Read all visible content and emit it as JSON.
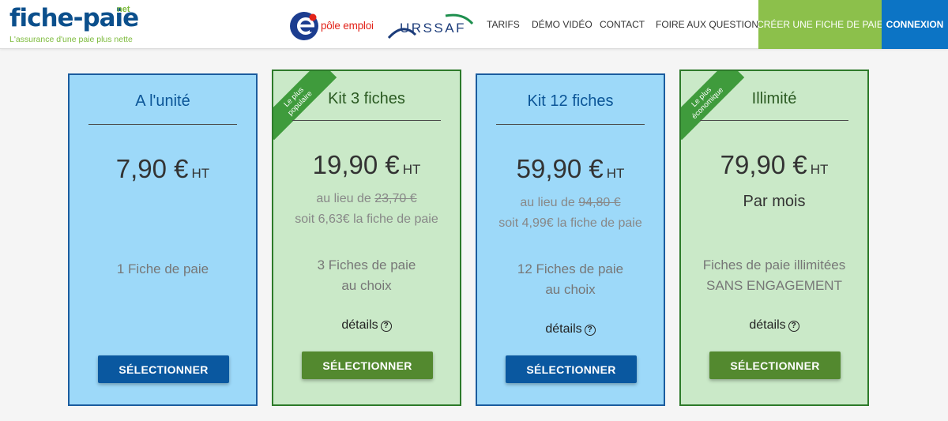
{
  "header": {
    "logo": {
      "word": "fiche-paie",
      "suffix": "net",
      "tagline": "L'assurance d'une paie plus nette"
    },
    "partners": {
      "pole_emploi": "pôle emploi",
      "urssaf": "URSSAF"
    },
    "nav": {
      "tarifs": "TARIFS",
      "demo": "DÉMO VIDÉO",
      "contact": "CONTACT",
      "faq": "FOIRE AUX QUESTIONS"
    },
    "create_button": "CRÉER UNE FICHE DE PAIE",
    "login_button": "CONNEXION",
    "colors": {
      "create": "#8cc04b",
      "login": "#0c74c5"
    }
  },
  "plans": [
    {
      "title": "A l'unité",
      "price": "7,90 €",
      "unit": "HT",
      "quantity": "1 Fiche de paie",
      "button": "SÉLECTIONNER",
      "color": "#9dd9f9"
    },
    {
      "ribbon_line1": "Le plus",
      "ribbon_line2": "populaire",
      "title": "Kit 3 fiches",
      "price": "19,90 €",
      "unit": "HT",
      "instead_prefix": "au lieu de",
      "old_price": "23,70 €",
      "per_sheet": "soit 6,63€ la fiche de paie",
      "quantity_line1": "3 Fiches de paie",
      "quantity_line2": "au choix",
      "details": "détails",
      "button": "SÉLECTIONNER",
      "color": "#cae9c8"
    },
    {
      "title": "Kit 12 fiches",
      "price": "59,90 €",
      "unit": "HT",
      "instead_prefix": "au lieu de",
      "old_price": "94,80 €",
      "per_sheet": "soit 4,99€ la fiche de paie",
      "quantity_line1": "12 Fiches de paie",
      "quantity_line2": "au choix",
      "details": "détails",
      "button": "SÉLECTIONNER",
      "color": "#9dd9f9"
    },
    {
      "ribbon_line1": "Le plus",
      "ribbon_line2": "économique",
      "title": "Illimité",
      "price": "79,90 €",
      "unit": "HT",
      "period": "Par mois",
      "quantity_line1": "Fiches de paie illimitées",
      "quantity_line2": "SANS ENGAGEMENT",
      "details": "détails",
      "button": "SÉLECTIONNER",
      "color": "#cae9c8"
    }
  ]
}
